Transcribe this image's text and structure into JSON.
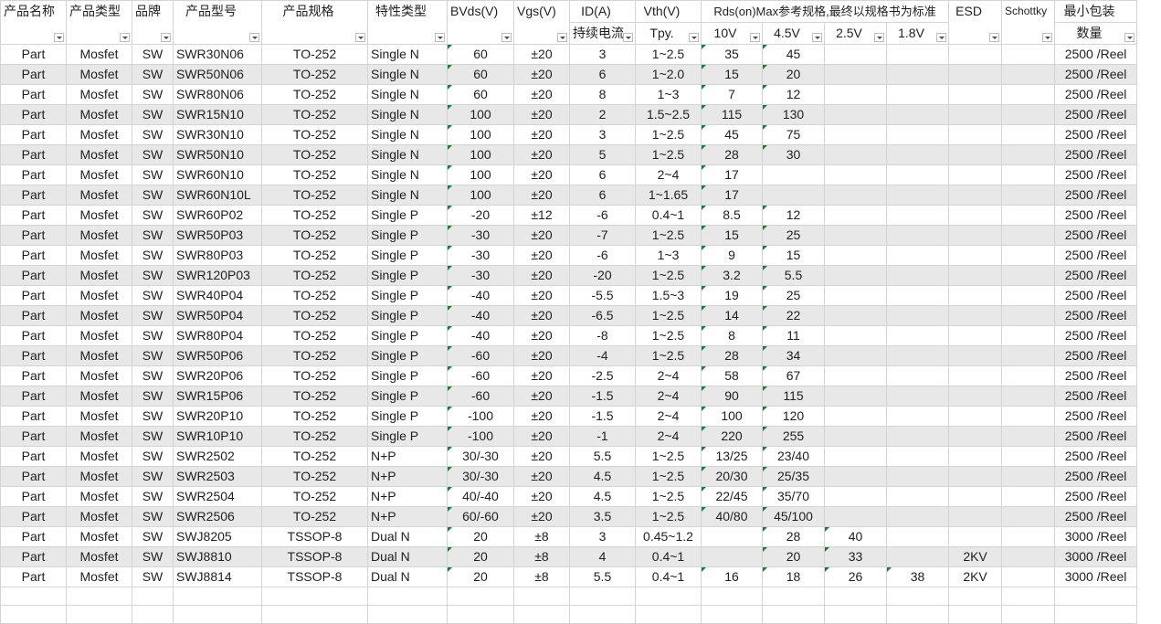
{
  "headers": {
    "name": "产品名称",
    "type": "产品类型",
    "brand": "品牌",
    "model": "产品型号",
    "pkg": "产品规格",
    "feature": "特性类型",
    "bvds": "BVds(V)",
    "vgs": "Vgs(V)",
    "id": "ID(A)",
    "id_sub": "持续电流",
    "vth": "Vth(V)",
    "vth_sub": "Tpy.",
    "rds": "Rds(on)Max参考规格,最终以规格书为标准",
    "rds_10v": "10V",
    "rds_45v": "4.5V",
    "rds_25v": "2.5V",
    "rds_18v": "1.8V",
    "esd": "ESD",
    "schottky": "Schottky",
    "minpack": "最小包装",
    "minpack_sub": "数量"
  },
  "rows": [
    [
      "Part",
      "Mosfet",
      "SW",
      "SWR30N06",
      "TO-252",
      "Single N",
      "60",
      "±20",
      "3",
      "1~2.5",
      "35",
      "45",
      "",
      "",
      "",
      "",
      "2500 /Reel"
    ],
    [
      "Part",
      "Mosfet",
      "SW",
      "SWR50N06",
      "TO-252",
      "Single N",
      "60",
      "±20",
      "6",
      "1~2.0",
      "15",
      "20",
      "",
      "",
      "",
      "",
      "2500 /Reel"
    ],
    [
      "Part",
      "Mosfet",
      "SW",
      "SWR80N06",
      "TO-252",
      "Single N",
      "60",
      "±20",
      "8",
      "1~3",
      "7",
      "12",
      "",
      "",
      "",
      "",
      "2500 /Reel"
    ],
    [
      "Part",
      "Mosfet",
      "SW",
      "SWR15N10",
      "TO-252",
      "Single N",
      "100",
      "±20",
      "2",
      "1.5~2.5",
      "115",
      "130",
      "",
      "",
      "",
      "",
      "2500 /Reel"
    ],
    [
      "Part",
      "Mosfet",
      "SW",
      "SWR30N10",
      "TO-252",
      "Single N",
      "100",
      "±20",
      "3",
      "1~2.5",
      "45",
      "75",
      "",
      "",
      "",
      "",
      "2500 /Reel"
    ],
    [
      "Part",
      "Mosfet",
      "SW",
      "SWR50N10",
      "TO-252",
      "Single N",
      "100",
      "±20",
      "5",
      "1~2.5",
      "28",
      "30",
      "",
      "",
      "",
      "",
      "2500 /Reel"
    ],
    [
      "Part",
      "Mosfet",
      "SW",
      "SWR60N10",
      "TO-252",
      "Single N",
      "100",
      "±20",
      "6",
      "2~4",
      "17",
      "",
      "",
      "",
      "",
      "",
      "2500 /Reel"
    ],
    [
      "Part",
      "Mosfet",
      "SW",
      "SWR60N10L",
      "TO-252",
      "Single N",
      "100",
      "±20",
      "6",
      "1~1.65",
      "17",
      "",
      "",
      "",
      "",
      "",
      "2500 /Reel"
    ],
    [
      "Part",
      "Mosfet",
      "SW",
      "SWR60P02",
      "TO-252",
      "Single P",
      "-20",
      "±12",
      "-6",
      "0.4~1",
      "8.5",
      "12",
      "",
      "",
      "",
      "",
      "2500 /Reel"
    ],
    [
      "Part",
      "Mosfet",
      "SW",
      "SWR50P03",
      "TO-252",
      "Single P",
      "-30",
      "±20",
      "-7",
      "1~2.5",
      "15",
      "25",
      "",
      "",
      "",
      "",
      "2500 /Reel"
    ],
    [
      "Part",
      "Mosfet",
      "SW",
      "SWR80P03",
      "TO-252",
      "Single P",
      "-30",
      "±20",
      "-6",
      "1~3",
      "9",
      "15",
      "",
      "",
      "",
      "",
      "2500 /Reel"
    ],
    [
      "Part",
      "Mosfet",
      "SW",
      "SWR120P03",
      "TO-252",
      "Single P",
      "-30",
      "±20",
      "-20",
      "1~2.5",
      "3.2",
      "5.5",
      "",
      "",
      "",
      "",
      "2500 /Reel"
    ],
    [
      "Part",
      "Mosfet",
      "SW",
      "SWR40P04",
      "TO-252",
      "Single P",
      "-40",
      "±20",
      "-5.5",
      "1.5~3",
      "19",
      "25",
      "",
      "",
      "",
      "",
      "2500 /Reel"
    ],
    [
      "Part",
      "Mosfet",
      "SW",
      "SWR50P04",
      "TO-252",
      "Single P",
      "-40",
      "±20",
      "-6.5",
      "1~2.5",
      "14",
      "22",
      "",
      "",
      "",
      "",
      "2500 /Reel"
    ],
    [
      "Part",
      "Mosfet",
      "SW",
      "SWR80P04",
      "TO-252",
      "Single P",
      "-40",
      "±20",
      "-8",
      "1~2.5",
      "8",
      "11",
      "",
      "",
      "",
      "",
      "2500 /Reel"
    ],
    [
      "Part",
      "Mosfet",
      "SW",
      "SWR50P06",
      "TO-252",
      "Single P",
      "-60",
      "±20",
      "-4",
      "1~2.5",
      "28",
      "34",
      "",
      "",
      "",
      "",
      "2500 /Reel"
    ],
    [
      "Part",
      "Mosfet",
      "SW",
      "SWR20P06",
      "TO-252",
      "Single P",
      "-60",
      "±20",
      "-2.5",
      "2~4",
      "58",
      "67",
      "",
      "",
      "",
      "",
      "2500 /Reel"
    ],
    [
      "Part",
      "Mosfet",
      "SW",
      "SWR15P06",
      "TO-252",
      "Single P",
      "-60",
      "±20",
      "-1.5",
      "2~4",
      "90",
      "115",
      "",
      "",
      "",
      "",
      "2500 /Reel"
    ],
    [
      "Part",
      "Mosfet",
      "SW",
      "SWR20P10",
      "TO-252",
      "Single P",
      "-100",
      "±20",
      "-1.5",
      "2~4",
      "100",
      "120",
      "",
      "",
      "",
      "",
      "2500 /Reel"
    ],
    [
      "Part",
      "Mosfet",
      "SW",
      "SWR10P10",
      "TO-252",
      "Single P",
      "-100",
      "±20",
      "-1",
      "2~4",
      "220",
      "255",
      "",
      "",
      "",
      "",
      "2500 /Reel"
    ],
    [
      "Part",
      "Mosfet",
      "SW",
      "SWR2502",
      "TO-252",
      "N+P",
      "30/-30",
      "±20",
      "5.5",
      "1~2.5",
      "13/25",
      "23/40",
      "",
      "",
      "",
      "",
      "2500 /Reel"
    ],
    [
      "Part",
      "Mosfet",
      "SW",
      "SWR2503",
      "TO-252",
      "N+P",
      "30/-30",
      "±20",
      "4.5",
      "1~2.5",
      "20/30",
      "25/35",
      "",
      "",
      "",
      "",
      "2500 /Reel"
    ],
    [
      "Part",
      "Mosfet",
      "SW",
      "SWR2504",
      "TO-252",
      "N+P",
      "40/-40",
      "±20",
      "4.5",
      "1~2.5",
      "22/45",
      "35/70",
      "",
      "",
      "",
      "",
      "2500 /Reel"
    ],
    [
      "Part",
      "Mosfet",
      "SW",
      "SWR2506",
      "TO-252",
      "N+P",
      "60/-60",
      "±20",
      "3.5",
      "1~2.5",
      "40/80",
      "45/100",
      "",
      "",
      "",
      "",
      "2500 /Reel"
    ],
    [
      "Part",
      "Mosfet",
      "SW",
      "SWJ8205",
      "TSSOP-8",
      "Dual N",
      "20",
      "±8",
      "3",
      "0.45~1.2",
      "",
      "28",
      "40",
      "",
      "",
      "",
      "3000 /Reel"
    ],
    [
      "Part",
      "Mosfet",
      "SW",
      "SWJ8810",
      "TSSOP-8",
      "Dual N",
      "20",
      "±8",
      "4",
      "0.4~1",
      "",
      "20",
      "33",
      "",
      "2KV",
      "",
      "3000 /Reel"
    ],
    [
      "Part",
      "Mosfet",
      "SW",
      "SWJ8814",
      "TSSOP-8",
      "Dual N",
      "20",
      "±8",
      "5.5",
      "0.4~1",
      "16",
      "18",
      "26",
      "38",
      "2KV",
      "",
      "3000 /Reel"
    ]
  ]
}
